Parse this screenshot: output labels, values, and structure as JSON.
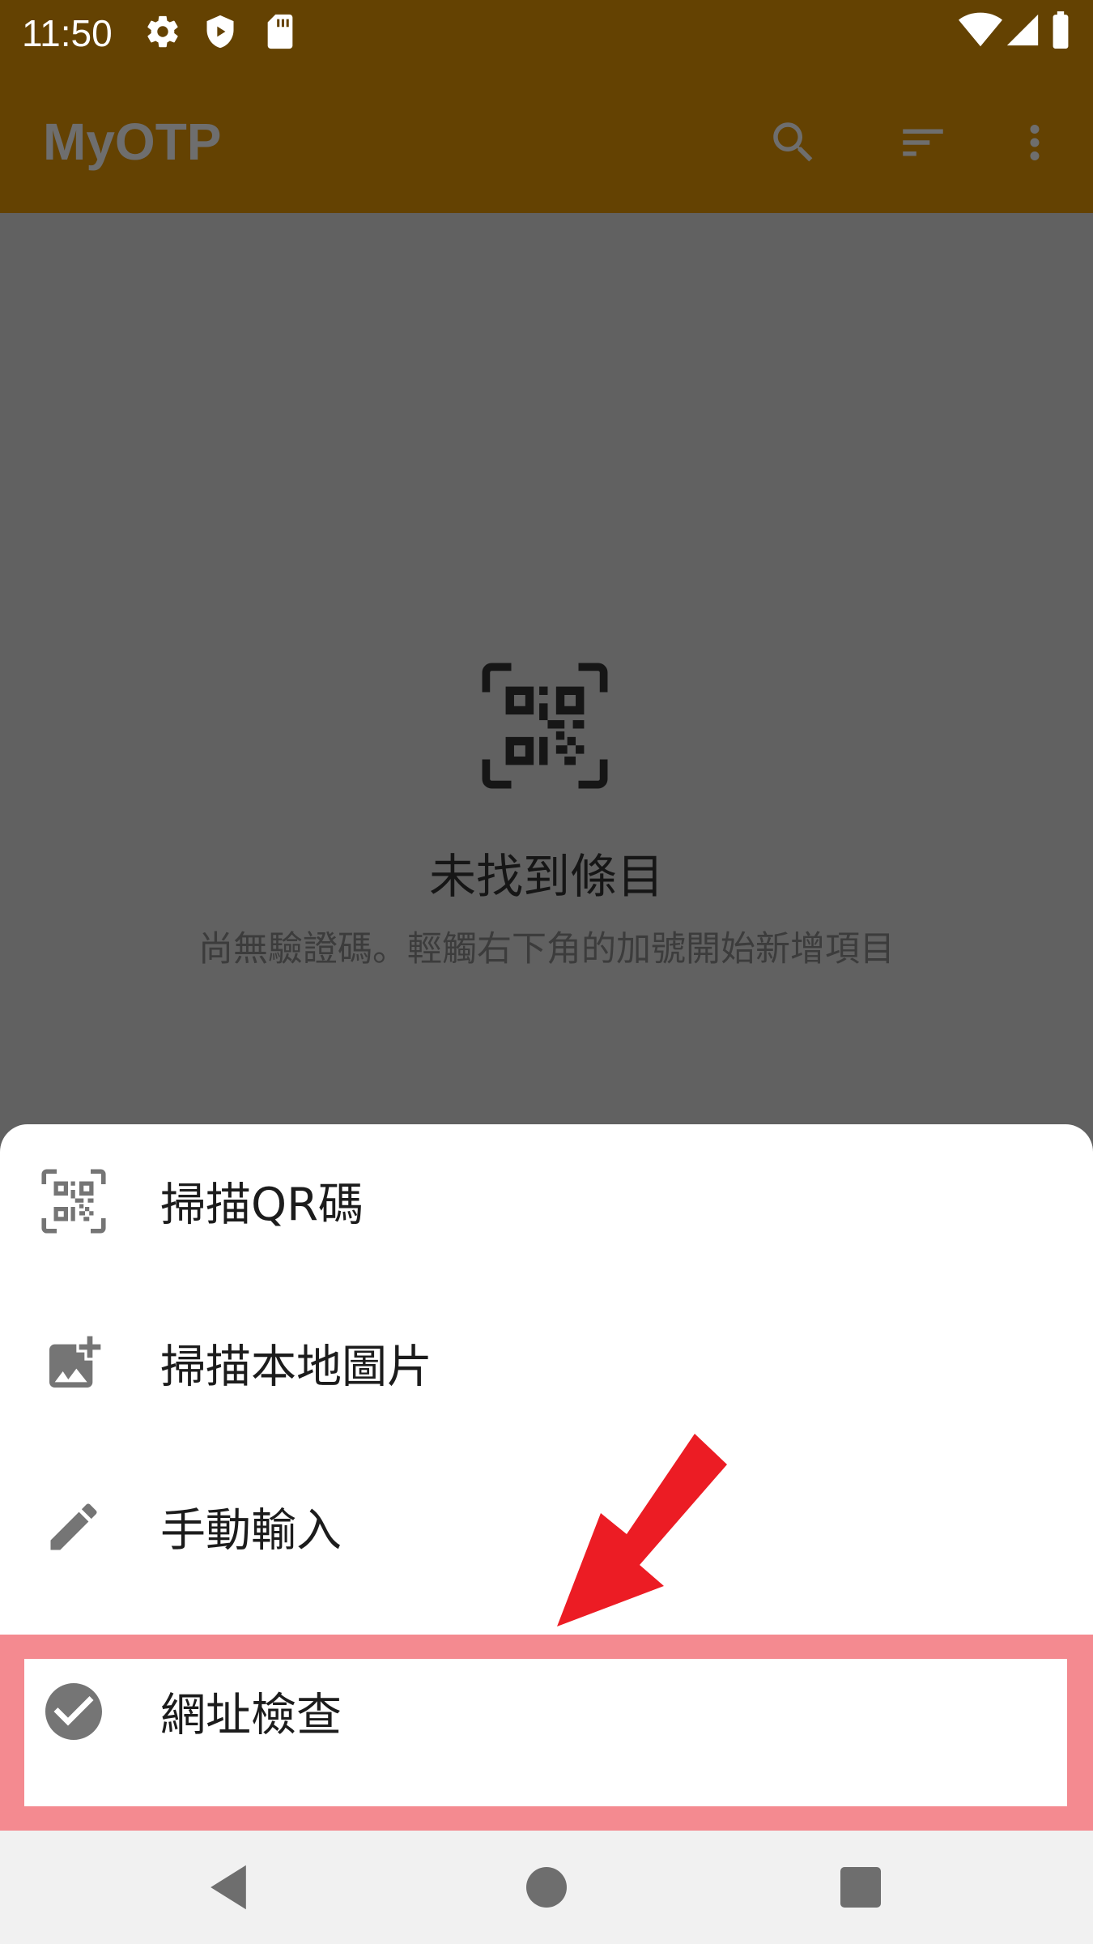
{
  "status_bar": {
    "time": "11:50",
    "icons_left": [
      "settings-icon",
      "shield-icon",
      "sd-card-icon"
    ],
    "icons_right": [
      "wifi-icon",
      "signal-icon",
      "battery-icon"
    ]
  },
  "app_bar": {
    "title": "MyOTP",
    "actions": [
      "search-icon",
      "sort-icon",
      "more-vert-icon"
    ]
  },
  "empty_state": {
    "icon": "qr-code-scan-icon",
    "title": "未找到條目",
    "subtitle": "尚無驗證碼。輕觸右下角的加號開始新增項目"
  },
  "bottom_sheet": {
    "items": [
      {
        "label": "掃描QR碼",
        "icon": "qr-code-scan-icon"
      },
      {
        "label": "掃描本地圖片",
        "icon": "add-photo-icon"
      },
      {
        "label": "手動輸入",
        "icon": "pencil-icon"
      },
      {
        "label": "網址檢查",
        "icon": "check-circle-icon"
      }
    ]
  },
  "annotation": {
    "highlight_color": "#f48a90",
    "arrow_color": "#ec1c24"
  },
  "nav_bar": {
    "buttons": [
      "back-icon",
      "home-icon",
      "recents-icon"
    ]
  }
}
